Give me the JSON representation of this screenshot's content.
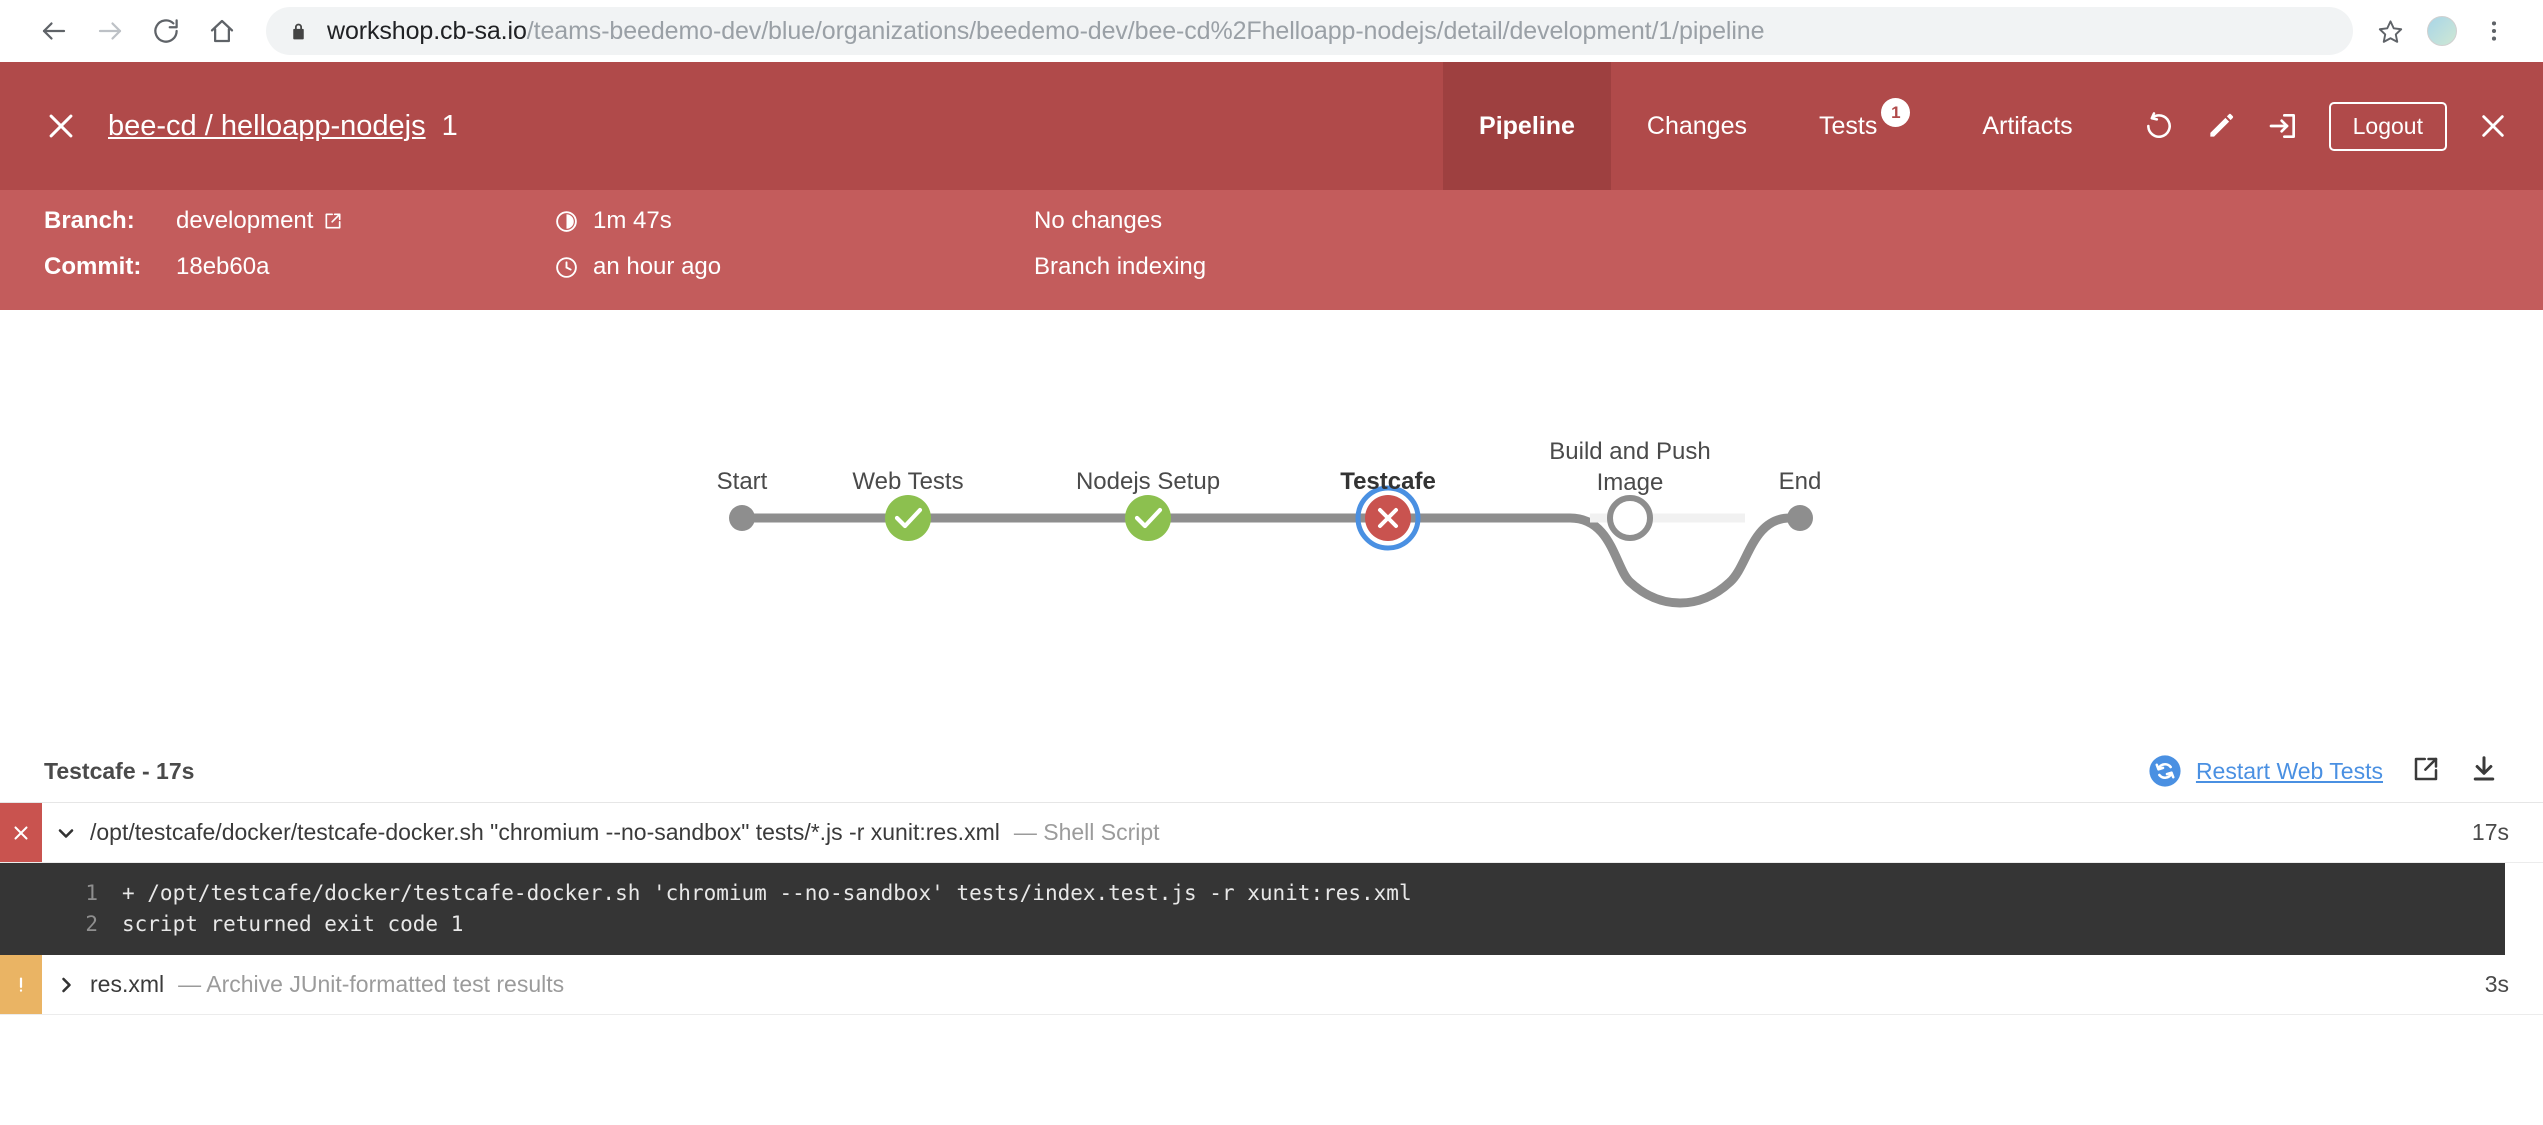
{
  "browser": {
    "back_icon": "back-arrow-icon",
    "forward_icon": "forward-arrow-icon",
    "reload_icon": "reload-icon",
    "home_icon": "home-icon",
    "lock_icon": "lock-icon",
    "url_host": "workshop.cb-sa.io",
    "url_path": "/teams-beedemo-dev/blue/organizations/beedemo-dev/bee-cd%2Fhelloapp-nodejs/detail/development/1/pipeline",
    "star_icon": "bookmark-star-icon",
    "profile_icon": "profile-avatar-icon",
    "menu_icon": "browser-menu-icon"
  },
  "header": {
    "close_icon": "close-icon",
    "pipeline_name": "bee-cd / helloapp-nodejs",
    "run_id": "1",
    "tabs": [
      {
        "label": "Pipeline",
        "active": true,
        "badge": ""
      },
      {
        "label": "Changes",
        "active": false,
        "badge": ""
      },
      {
        "label": "Tests",
        "active": false,
        "badge": "1"
      },
      {
        "label": "Artifacts",
        "active": false,
        "badge": ""
      }
    ],
    "actions": {
      "replay_icon": "replay-icon",
      "edit_icon": "edit-pencil-icon",
      "login_icon": "login-arrow-icon",
      "logout_label": "Logout",
      "close_icon": "close-icon"
    },
    "colors": {
      "header_bg": "#b04a4a",
      "header_bg_active_tab": "#9e4040",
      "meta_bg": "#c35c5c"
    }
  },
  "meta": {
    "branch_label": "Branch:",
    "branch_value": "development",
    "branch_external_icon": "external-link-icon",
    "commit_label": "Commit:",
    "commit_value": "18eb60a",
    "duration_icon": "duration-icon",
    "duration_value": "1m 47s",
    "time_icon": "clock-icon",
    "time_value": "an hour ago",
    "changes_text": "No changes",
    "cause_text": "Branch indexing"
  },
  "pipeline": {
    "stages": [
      {
        "label": "Start",
        "status": "start",
        "selected": false
      },
      {
        "label": "Web Tests",
        "status": "success",
        "selected": false
      },
      {
        "label": "Nodejs Setup",
        "status": "success",
        "selected": false
      },
      {
        "label": "Testcafe",
        "status": "failure",
        "selected": true
      },
      {
        "label": "Build and Push Image",
        "status": "skipped",
        "selected": false
      },
      {
        "label": "End",
        "status": "end",
        "selected": false
      }
    ],
    "colors": {
      "success": "#8cc04f",
      "failure": "#c9534f",
      "selected_ring": "#4a90e2",
      "line": "#8e8e8e",
      "skipped_line": "#f1f1f1"
    }
  },
  "log": {
    "title": "Testcafe - 17s",
    "restart_icon": "restart-icon",
    "restart_label": "Restart Web Tests",
    "open_external_icon": "external-link-icon",
    "download_icon": "download-icon",
    "steps": [
      {
        "status": "fail",
        "status_glyph": "✕",
        "expanded": true,
        "chevron": "▾",
        "title": "/opt/testcafe/docker/testcafe-docker.sh \"chromium --no-sandbox\" tests/*.js -r xunit:res.xml",
        "description": "— Shell Script",
        "duration": "17s",
        "console": [
          {
            "n": "1",
            "text": "+ /opt/testcafe/docker/testcafe-docker.sh 'chromium --no-sandbox' tests/index.test.js -r xunit:res.xml"
          },
          {
            "n": "2",
            "text": "script returned exit code 1"
          }
        ]
      },
      {
        "status": "warn",
        "status_glyph": "!",
        "expanded": false,
        "chevron": "❯",
        "title": "res.xml",
        "description": "— Archive JUnit-formatted test results",
        "duration": "3s",
        "console": []
      }
    ]
  }
}
